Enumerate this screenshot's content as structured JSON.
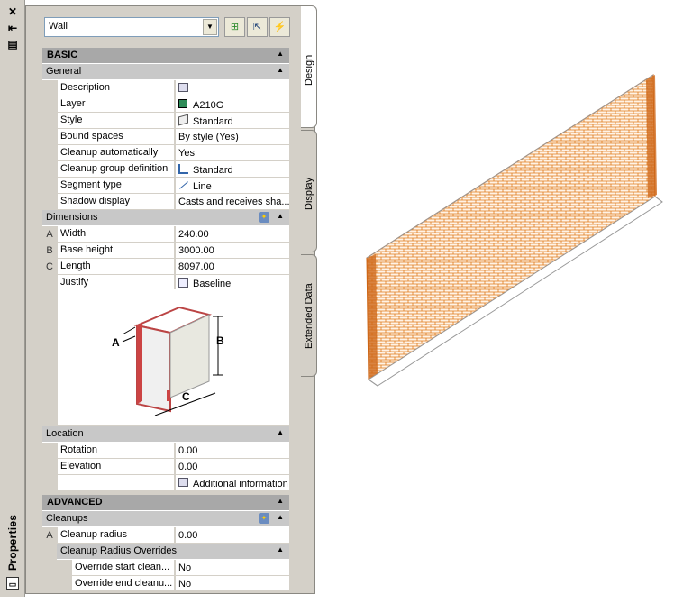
{
  "panel": {
    "title": "Properties",
    "object_type": "Wall"
  },
  "tabs": [
    "Design",
    "Display",
    "Extended Data"
  ],
  "sections": {
    "basic": "BASIC",
    "general": "General",
    "dimensions": "Dimensions",
    "location": "Location",
    "advanced": "ADVANCED",
    "cleanups": "Cleanups",
    "cleanup_radius_overrides": "Cleanup Radius Overrides"
  },
  "general": [
    {
      "name": "Description",
      "value": ""
    },
    {
      "name": "Layer",
      "value": "A210G"
    },
    {
      "name": "Style",
      "value": "Standard"
    },
    {
      "name": "Bound spaces",
      "value": "By style (Yes)"
    },
    {
      "name": "Cleanup automatically",
      "value": "Yes"
    },
    {
      "name": "Cleanup group definition",
      "value": "Standard"
    },
    {
      "name": "Segment type",
      "value": "Line"
    },
    {
      "name": "Shadow display",
      "value": "Casts and receives sha..."
    }
  ],
  "dimensions": [
    {
      "letter": "A",
      "name": "Width",
      "value": "240.00"
    },
    {
      "letter": "B",
      "name": "Base height",
      "value": "3000.00"
    },
    {
      "letter": "C",
      "name": "Length",
      "value": "8097.00"
    },
    {
      "letter": "",
      "name": "Justify",
      "value": "Baseline"
    }
  ],
  "diagram_labels": {
    "a": "A",
    "b": "B",
    "c": "C"
  },
  "location": [
    {
      "name": "Rotation",
      "value": "0.00"
    },
    {
      "name": "Elevation",
      "value": "0.00"
    },
    {
      "name": "",
      "value": "Additional information"
    }
  ],
  "cleanups": [
    {
      "letter": "A",
      "name": "Cleanup radius",
      "value": "0.00"
    }
  ],
  "overrides": [
    {
      "name": "Override start clean...",
      "value": "No"
    },
    {
      "name": "Override end cleanu...",
      "value": "No"
    }
  ],
  "colors": {
    "layer_swatch": "#2e8b57",
    "brick": "#e07a1a"
  }
}
